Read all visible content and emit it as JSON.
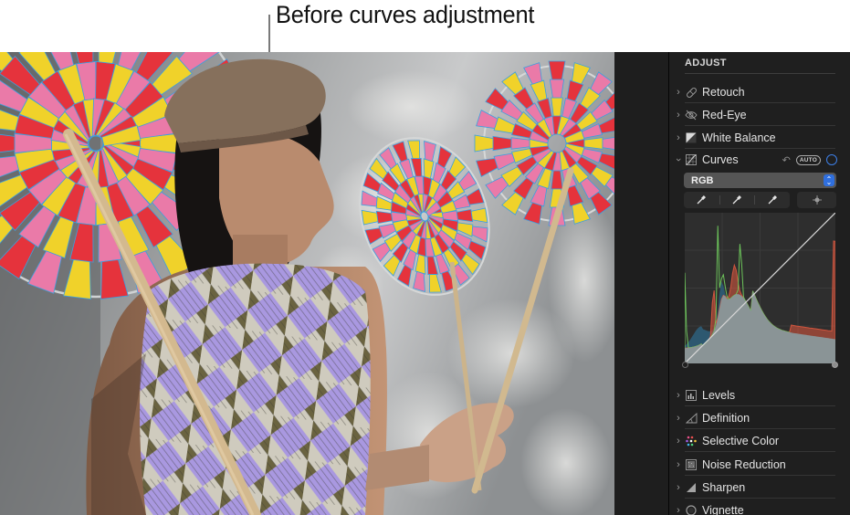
{
  "callout": {
    "text": "Before curves adjustment"
  },
  "sidebar": {
    "title": "ADJUST",
    "items": [
      {
        "label": "Retouch",
        "icon": "bandage-icon",
        "expanded": false
      },
      {
        "label": "Red-Eye",
        "icon": "eye-slash-icon",
        "expanded": false
      },
      {
        "label": "White Balance",
        "icon": "white-balance-icon",
        "expanded": false
      },
      {
        "label": "Curves",
        "icon": "curves-icon",
        "expanded": true
      },
      {
        "label": "Levels",
        "icon": "levels-icon",
        "expanded": false
      },
      {
        "label": "Definition",
        "icon": "definition-icon",
        "expanded": false
      },
      {
        "label": "Selective Color",
        "icon": "selective-color-icon",
        "expanded": false
      },
      {
        "label": "Noise Reduction",
        "icon": "noise-reduction-icon",
        "expanded": false
      },
      {
        "label": "Sharpen",
        "icon": "sharpen-icon",
        "expanded": false
      },
      {
        "label": "Vignette",
        "icon": "vignette-icon",
        "expanded": false
      }
    ],
    "curves": {
      "undo_symbol": "↶",
      "auto_label": "AUTO",
      "channel_value": "RGB",
      "stepper_up": "⌃",
      "stepper_down": "⌄",
      "pickers": [
        "black-point-eyedropper",
        "gray-point-eyedropper",
        "white-point-eyedropper"
      ],
      "target_tool": "add-point-target"
    }
  },
  "colors": {
    "accent": "#3d7fe6",
    "panel_bg": "#1f1f1f",
    "histogram_red": "#d0553e",
    "histogram_green": "#6cc35a",
    "histogram_blue": "#2e5d78",
    "histogram_luma": "#8a9496"
  }
}
